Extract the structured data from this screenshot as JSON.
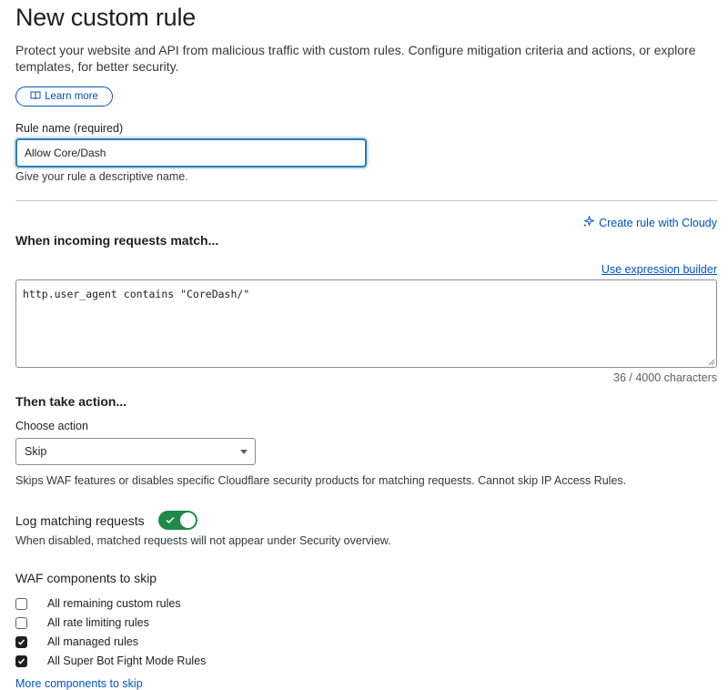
{
  "page": {
    "title": "New custom rule",
    "description": "Protect your website and API from malicious traffic with custom rules. Configure mitigation criteria and actions, or explore templates, for better security.",
    "learn_more": "Learn more"
  },
  "rule_name": {
    "label": "Rule name (required)",
    "value": "Allow Core/Dash",
    "help": "Give your rule a descriptive name."
  },
  "match": {
    "cloudy_link": "Create rule with Cloudy",
    "title": "When incoming requests match...",
    "builder_link": "Use expression builder",
    "expression": "http.user_agent contains \"CoreDash/\"",
    "char_count": "36 / 4000 characters"
  },
  "action": {
    "title": "Then take action...",
    "choose_label": "Choose action",
    "selected": "Skip",
    "help": "Skips WAF features or disables specific Cloudflare security products for matching requests. Cannot skip IP Access Rules."
  },
  "logging": {
    "label": "Log matching requests",
    "enabled": true,
    "help": "When disabled, matched requests will not appear under Security overview."
  },
  "waf": {
    "title": "WAF components to skip",
    "components": [
      {
        "label": "All remaining custom rules",
        "checked": false
      },
      {
        "label": "All rate limiting rules",
        "checked": false
      },
      {
        "label": "All managed rules",
        "checked": true
      },
      {
        "label": "All Super Bot Fight Mode Rules",
        "checked": true
      }
    ],
    "more_link": "More components to skip"
  },
  "colors": {
    "link": "#0051c3",
    "toggle_on": "#1e8a4a",
    "focus_border": "#2c7cb0"
  }
}
